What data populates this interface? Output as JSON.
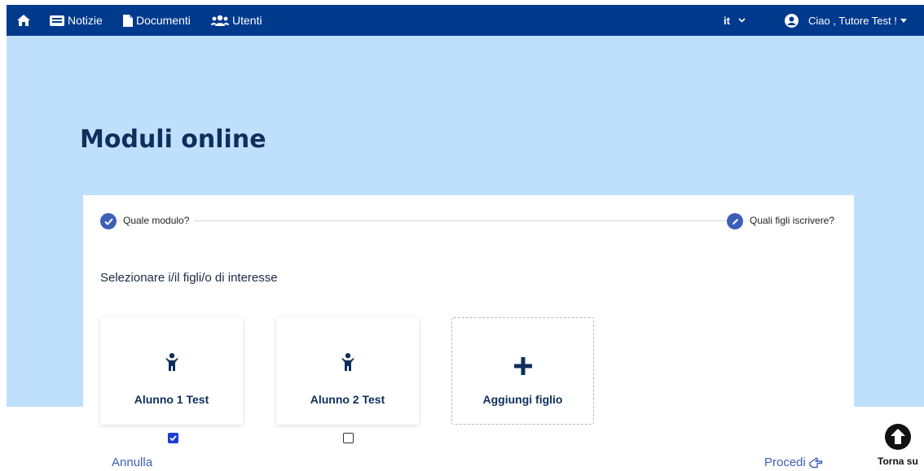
{
  "nav": {
    "home_icon": "home-icon",
    "items": [
      {
        "label": "Notizie",
        "icon": "newspaper-icon"
      },
      {
        "label": "Documenti",
        "icon": "file-icon"
      },
      {
        "label": "Utenti",
        "icon": "users-icon"
      }
    ],
    "language": "it",
    "greeting": "Ciao , Tutore Test !"
  },
  "page": {
    "title": "Moduli online"
  },
  "stepper": {
    "steps": [
      {
        "label": "Quale modulo?",
        "state": "completed"
      },
      {
        "label": "Quali figli iscrivere?",
        "state": "current"
      }
    ]
  },
  "selection": {
    "instruction": "Selezionare i/il figli/o di interesse",
    "children": [
      {
        "name": "Alunno 1 Test",
        "checked": true
      },
      {
        "name": "Alunno 2 Test",
        "checked": false
      }
    ],
    "add_label": "Aggiungi figlio"
  },
  "actions": {
    "cancel": "Annulla",
    "proceed": "Procedi",
    "back_to_top": "Torna su"
  },
  "colors": {
    "nav_bg": "#003a8c",
    "hero_bg": "#bee0fc",
    "accent": "#3d5fb8",
    "title": "#0e2f5c"
  }
}
